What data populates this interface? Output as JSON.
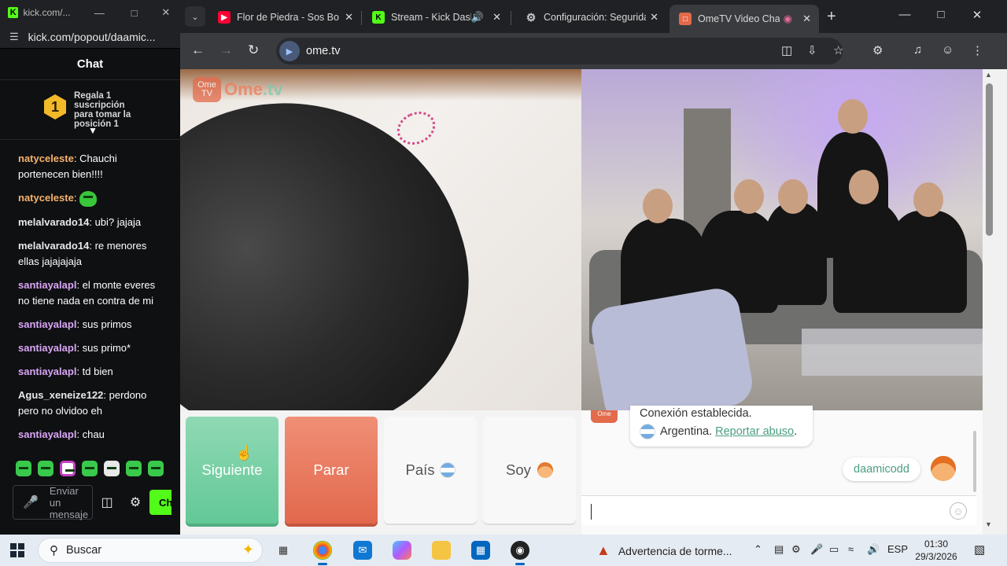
{
  "kick_window": {
    "title": "kick.com/...",
    "url": "kick.com/popout/daamic...",
    "chat_header": "Chat",
    "promo": {
      "rank": "1",
      "text": "Regala 1 suscripción para tomar la posición 1"
    },
    "messages": [
      {
        "user": "natyceleste",
        "color": "#f6b26b",
        "text": "Chauchi portenecen bien!!!!"
      },
      {
        "user": "natyceleste",
        "color": "#f6b26b",
        "text": ""
      },
      {
        "user": "melalvarado14",
        "color": "#e8e8e8",
        "text": "ubi? jajaja"
      },
      {
        "user": "melalvarado14",
        "color": "#e8e8e8",
        "text": "re menores ellas jajajajaja"
      },
      {
        "user": "santiayalapl",
        "color": "#d9a6f5",
        "text": "el monte everes no tiene nada en contra de mi"
      },
      {
        "user": "santiayalapl",
        "color": "#d9a6f5",
        "text": "sus primos"
      },
      {
        "user": "santiayalapl",
        "color": "#d9a6f5",
        "text": "sus primo*"
      },
      {
        "user": "santiayalapl",
        "color": "#d9a6f5",
        "text": "td bien"
      },
      {
        "user": "Agus_xeneize122",
        "color": "#e8e8e8",
        "text": "perdono pero no olvidoo eh"
      },
      {
        "user": "santiayalapl",
        "color": "#d9a6f5",
        "text": "chau"
      }
    ],
    "input_placeholder": "Enviar un mensaje",
    "chat_button": "Ch"
  },
  "browser": {
    "tabs": [
      {
        "title": "Flor de Piedra - Sos Bot",
        "favicon": "youtube-icon",
        "color": "#ff0033"
      },
      {
        "title": "Stream - Kick Dashb",
        "favicon": "kick-icon",
        "color": "#53fc18"
      },
      {
        "title": "Configuración: Seguridad",
        "favicon": "gear-icon",
        "color": "#bbbbbb"
      },
      {
        "title": "OmeTV Video Chat",
        "favicon": "ometv-icon",
        "color": "#e36a4a"
      }
    ],
    "url": "ome.tv"
  },
  "ometv": {
    "logo_main": "Ome",
    "logo_tv": ".tv",
    "logo_box": "Ome TV",
    "buttons": {
      "next": "Siguiente",
      "stop": "Parar",
      "country": "País",
      "gender": "Soy"
    },
    "system_line1": "Conexión establecida.",
    "country": "Argentina.",
    "report": "Reportar abuso",
    "report_suffix": ".",
    "my_message": "daamicodd",
    "accent": "#4b9e7f"
  },
  "taskbar": {
    "search": "Buscar",
    "weather": "Advertencia de torme...",
    "lang": "ESP",
    "time": "01:30",
    "date": "29/3/2026"
  }
}
